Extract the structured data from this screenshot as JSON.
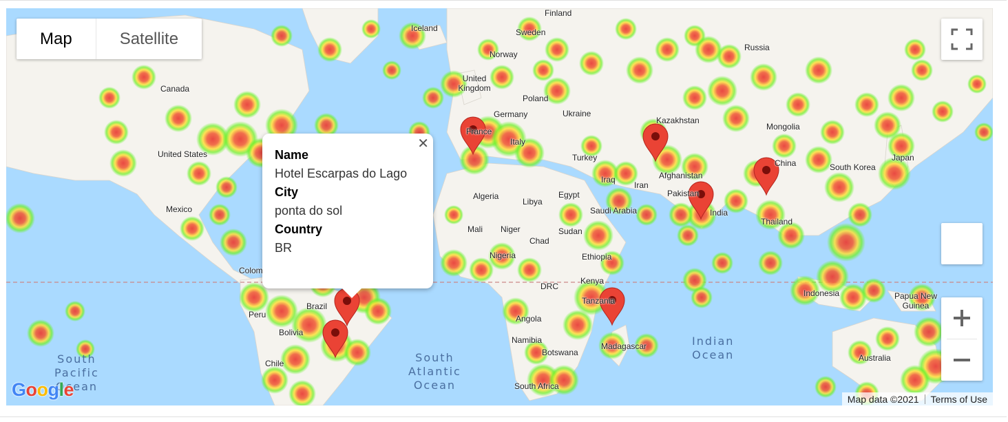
{
  "map_type": {
    "options": [
      "Map",
      "Satellite"
    ],
    "selected": "Map"
  },
  "controls": {
    "fullscreen_icon": "fullscreen-icon",
    "zoom_in_icon": "plus-icon",
    "zoom_out_icon": "minus-icon"
  },
  "info_window": {
    "name_label": "Name",
    "name_value": "Hotel Escarpas do Lago",
    "city_label": "City",
    "city_value": "ponta do sol",
    "country_label": "Country",
    "country_value": "BR",
    "close_icon": "close-icon"
  },
  "attribution": {
    "logo": "Google",
    "map_data": "Map data ©2021",
    "terms": "Terms of Use"
  },
  "places": [
    "Finland",
    "Sweden",
    "Norway",
    "Iceland",
    "Russia",
    "Canada",
    "United Kingdom",
    "Poland",
    "Germany",
    "Ukraine",
    "France",
    "Italy",
    "Kazakhstan",
    "Mongolia",
    "United States",
    "Turkey",
    "Iraq",
    "Iran",
    "Afghanistan",
    "China",
    "South Korea",
    "Japan",
    "Pakistan",
    "India",
    "Mexico",
    "Algeria",
    "Libya",
    "Egypt",
    "Saudi Arabia",
    "Mali",
    "Niger",
    "Sudan",
    "Chad",
    "Thailand",
    "Nigeria",
    "Ethiopia",
    "Colombia",
    "Kenya",
    "DRC",
    "Brazil",
    "Tanzania",
    "Peru",
    "Angola",
    "Indonesia",
    "Papua New Guinea",
    "Bolivia",
    "Namibia",
    "Botswana",
    "Madagascar",
    "Chile",
    "South Africa",
    "Australia"
  ],
  "oceans": [
    "South Pacific Ocean",
    "South Atlantic Ocean",
    "Indian Ocean"
  ],
  "colors": {
    "water": "#aadaff",
    "land": "#f5f3ee",
    "heat_low": "#6ef02b",
    "heat_mid": "#ffe03a",
    "heat_high": "#e8403a",
    "marker": "#ea4335"
  },
  "marker_icon": "map-pin-icon",
  "marker_count": 7
}
